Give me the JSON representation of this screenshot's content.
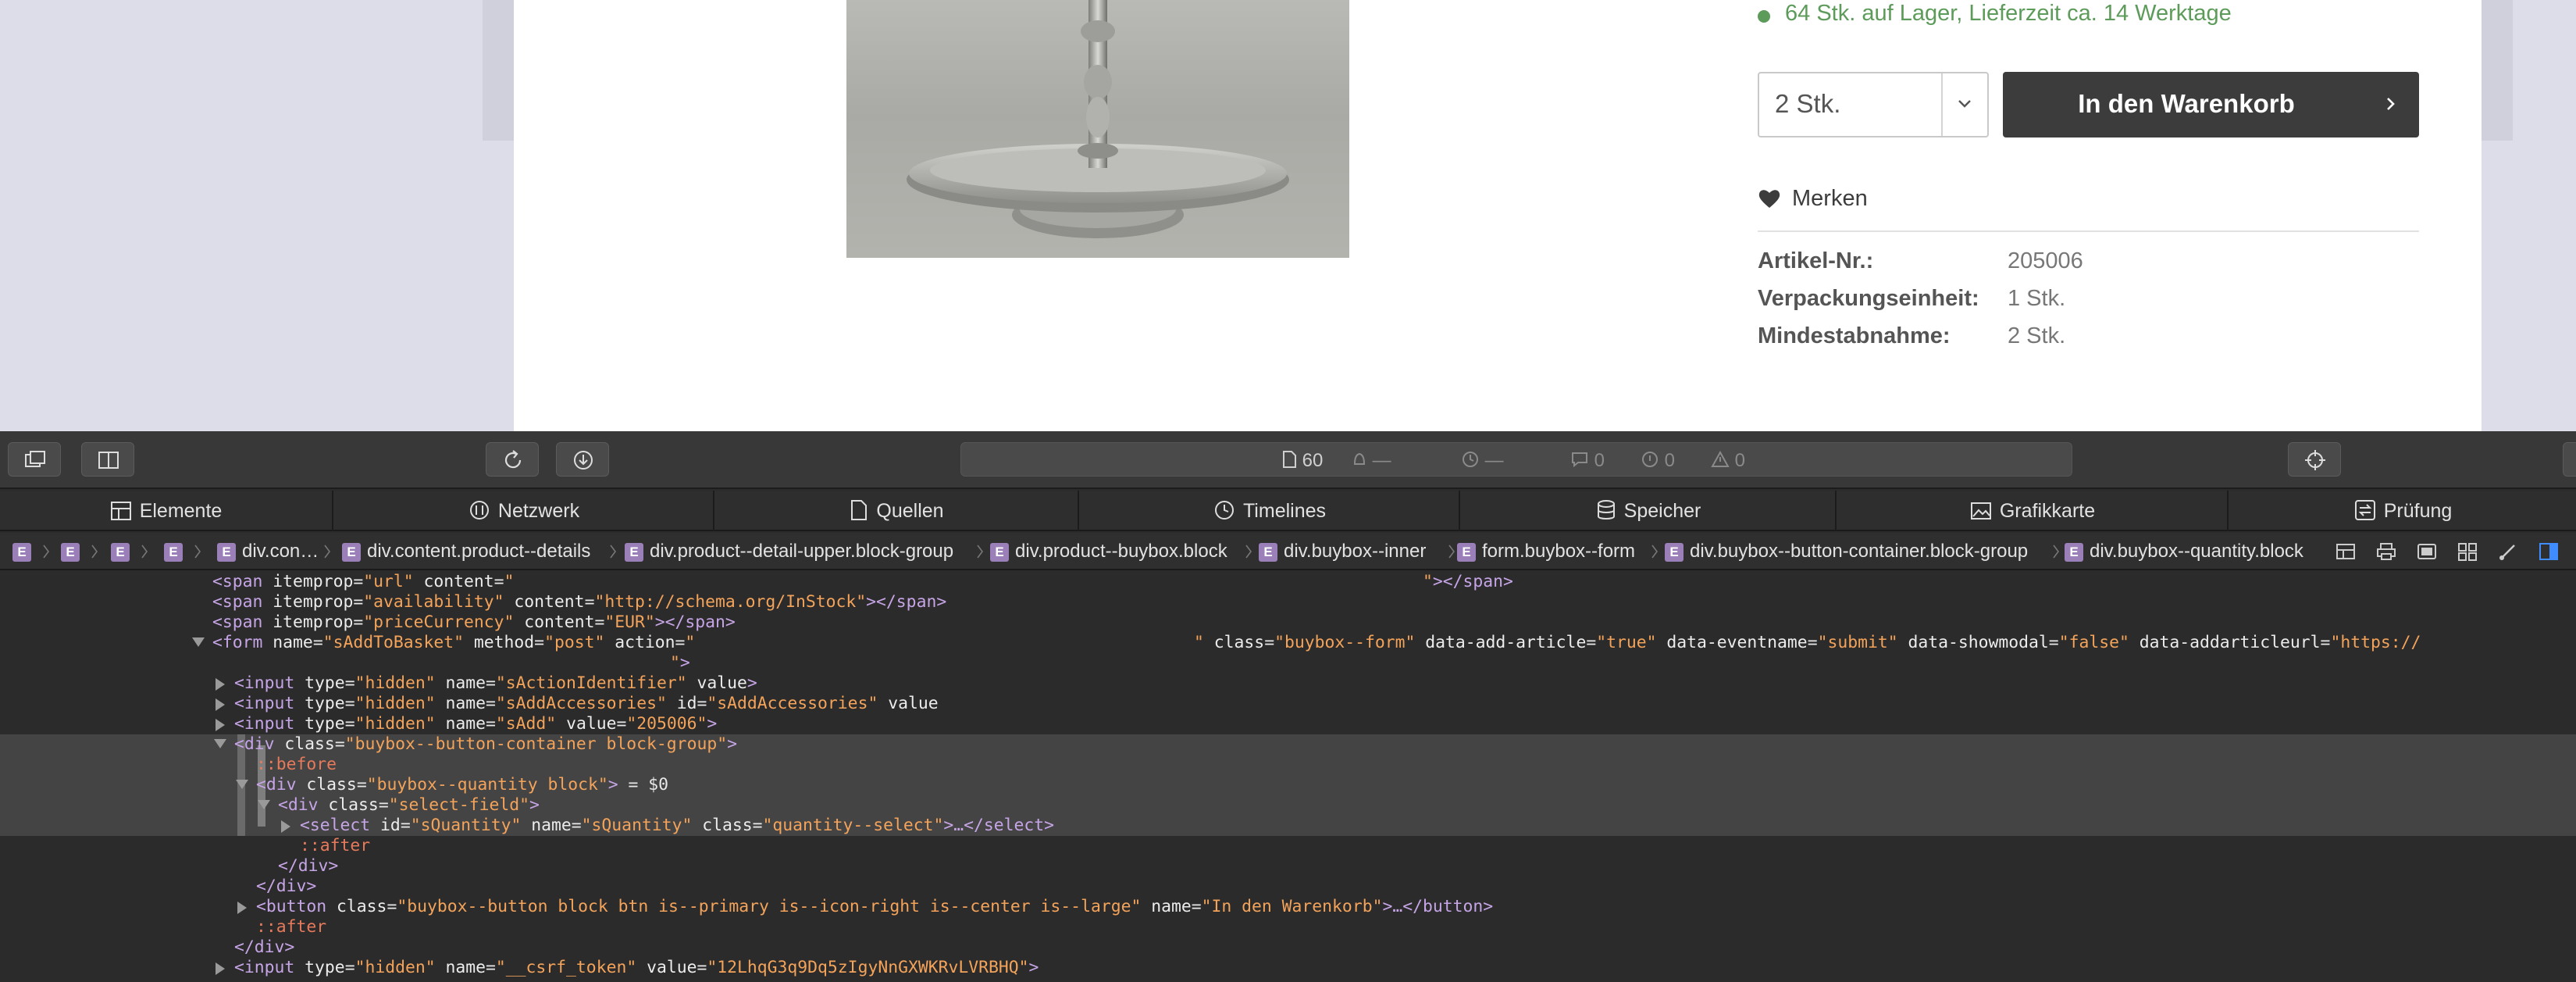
{
  "product": {
    "stock_text": "64 Stk. auf Lager, Lieferzeit ca. 14 Werktage",
    "quantity_value": "2 Stk.",
    "add_to_cart_label": "In den Warenkorb",
    "wishlist_label": "Merken",
    "properties": [
      {
        "label": "Artikel-Nr.:",
        "value": "205006"
      },
      {
        "label": "Verpackungseinheit:",
        "value": "1 Stk."
      },
      {
        "label": "Mindestabnahme:",
        "value": "2 Stk."
      }
    ],
    "colors": {
      "stock": "#5d9b5a",
      "cart_button": "#3c3c3c"
    }
  },
  "devtools": {
    "status": {
      "resources": "60",
      "network": "—",
      "time": "—",
      "logs": "0",
      "errors": "0",
      "warnings": "0"
    },
    "tabs": [
      {
        "label": "Elemente",
        "icon": "elements-icon"
      },
      {
        "label": "Netzwerk",
        "icon": "network-icon"
      },
      {
        "label": "Quellen",
        "icon": "sources-icon"
      },
      {
        "label": "Timelines",
        "icon": "timelines-icon"
      },
      {
        "label": "Speicher",
        "icon": "storage-icon"
      },
      {
        "label": "Grafikkarte",
        "icon": "graphics-icon"
      },
      {
        "label": "Prüfung",
        "icon": "audit-icon"
      }
    ],
    "breadcrumb": [
      "div.con…",
      "div.content.product--details",
      "div.product--detail-upper.block-group",
      "div.product--buybox.block",
      "div.buybox--inner",
      "form.buybox--form",
      "div.buybox--button-container.block-group",
      "div.buybox--quantity.block"
    ],
    "code": {
      "l1_tag": "<span",
      "l1_a1": "itemprop",
      "l1_v1": "\"url\"",
      "l1_a2": "content",
      "l1_v2": "\"",
      "l1_v2b": "\"",
      "l1_end": "></span>",
      "l2_a2v": "\"availability\"",
      "l2_v2": "\"http://schema.org/InStock\"",
      "l3_v1": "\"priceCurrency\"",
      "l3_v2": "\"EUR\"",
      "l4_tag": "<form",
      "l4_a1": "name",
      "l4_v1": "\"sAddToBasket\"",
      "l4_a2": "method",
      "l4_v2": "\"post\"",
      "l4_a3": "action",
      "l4_v3": "\"",
      "l4_v3b": "\"",
      "l4_a4": "class",
      "l4_v4": "\"buybox--form\"",
      "l4_a5": "data-add-article",
      "l4_v5": "\"true\"",
      "l4_a6": "data-eventname",
      "l4_v6": "\"submit\"",
      "l4_a7": "data-showmodal",
      "l4_v7": "\"false\"",
      "l4_a8": "data-addarticleurl",
      "l4_v8": "\"https://",
      "l5_v": "\"",
      "l5_end": ">",
      "in_tag": "<input",
      "type": "type",
      "hidden": "\"hidden\"",
      "name": "name",
      "value": "value",
      "id": "id",
      "l6_v": "\"sActionIdentifier\"",
      "l7_v": "\"sAddAccessories\"",
      "l8_v": "\"sAdd\"",
      "l8_val": "\"205006\"",
      "div_tag": "<div",
      "class": "class",
      "l9_v": "\"buybox--button-container block-group\"",
      "before": "::before",
      "l11_v": "\"buybox--quantity block\"",
      "l11_eq": " = $0",
      "l12_v": "\"select-field\"",
      "sel_tag": "<select",
      "l13_id": "\"sQuantity\"",
      "l13_cls": "\"quantity--select\"",
      "l13_end": ">…</select>",
      "after": "::after",
      "div_close": "</div>",
      "btn_tag": "<button",
      "l17_cls": "\"buybox--button block btn is--primary is--icon-right is--center is--large\"",
      "l17_name": "\"In den Warenkorb\"",
      "l17_end": ">…</button>",
      "l20_name": "\"__csrf_token\"",
      "l20_val": "\"12LhqG3q9Dq5zIgyNnGXWKRvLVRBHQ\"",
      "gt": ">",
      "gt_span": "></span>",
      "eq": "="
    }
  }
}
